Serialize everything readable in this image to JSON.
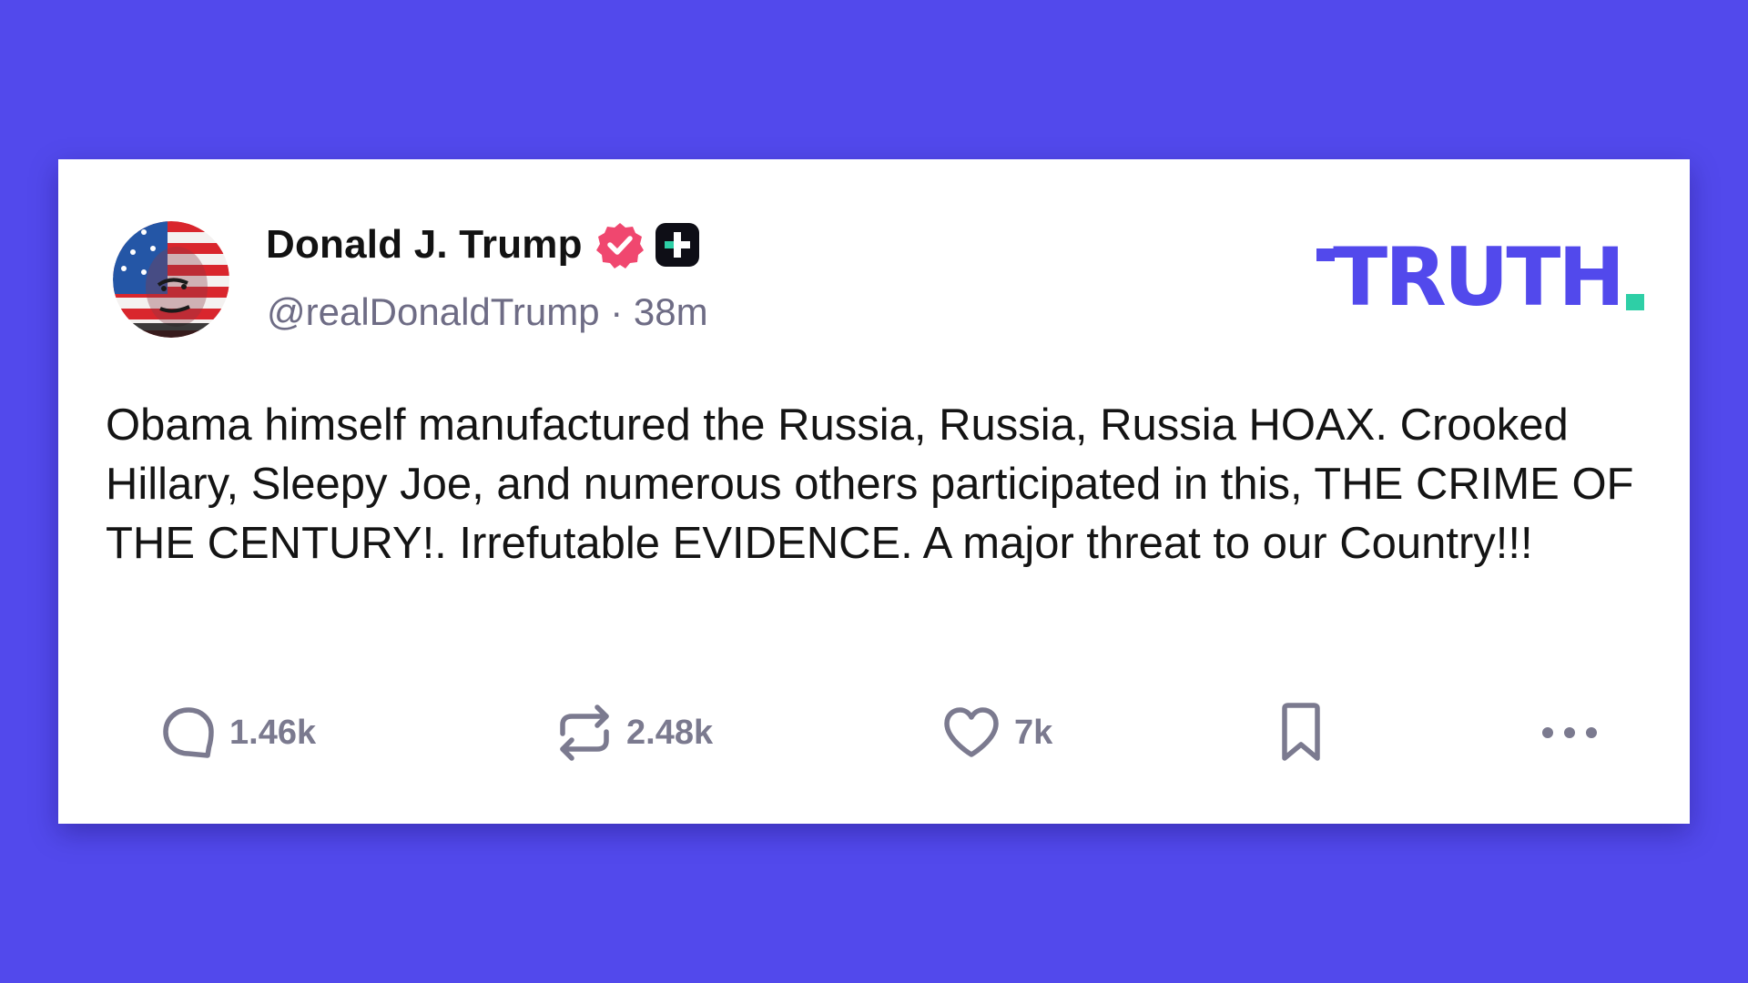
{
  "colors": {
    "background": "#5249ec",
    "brand_purple": "#5249ec",
    "brand_teal": "#2ecfa6",
    "verified_pink": "#f0476f",
    "muted_text": "#6e6c85"
  },
  "post": {
    "author": {
      "display_name": "Donald J. Trump",
      "handle": "@realDonaldTrump",
      "separator": "·",
      "time_ago": "38m",
      "avatar_icon": "avatar-flag-portrait",
      "badges": [
        "verified-icon",
        "plus-icon"
      ]
    },
    "body": "Obama himself manufactured the Russia, Russia, Russia HOAX. Crooked Hillary, Sleepy Joe, and numerous others participated in this, THE CRIME OF THE CENTURY!. Irrefutable EVIDENCE. A major threat to our Country!!!",
    "actions": {
      "replies": {
        "icon": "reply-icon",
        "count": "1.46k"
      },
      "retruths": {
        "icon": "repost-icon",
        "count": "2.48k"
      },
      "likes": {
        "icon": "heart-icon",
        "count": "7k"
      },
      "bookmark": {
        "icon": "bookmark-icon"
      },
      "more": {
        "icon": "more-icon"
      }
    }
  },
  "brand": {
    "logo_text": "TRUTH"
  }
}
